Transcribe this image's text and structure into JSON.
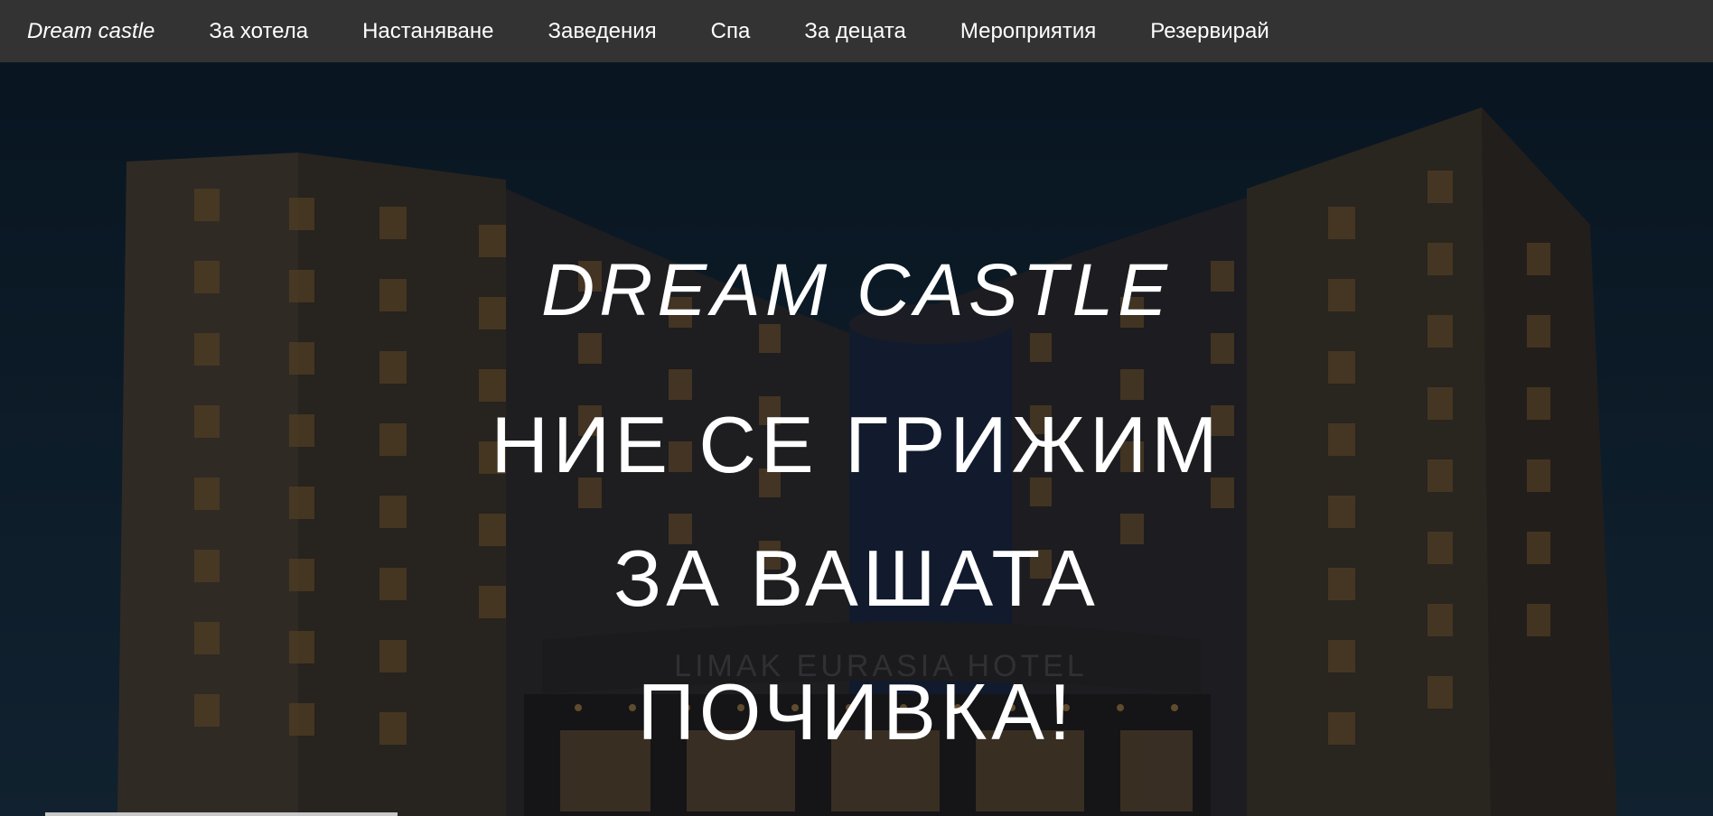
{
  "nav": {
    "brand": "Dream castle",
    "links": [
      "За хотела",
      "Настаняване",
      "Заведения",
      "Спа",
      "За децата",
      "Мероприятия",
      "Резервирай"
    ]
  },
  "hero": {
    "title": "DREAM CASTLE",
    "slogan": "НИЕ СЕ ГРИЖИМ ЗА ВАШАТА ПОЧИВКА!",
    "building_sign": "LIMAK EURASIA HOTEL"
  },
  "colors": {
    "navbar": "#333333",
    "text": "#ffffff",
    "sky": "#12283c",
    "building": "#3a342e",
    "window_light": "#8a6a3e"
  }
}
